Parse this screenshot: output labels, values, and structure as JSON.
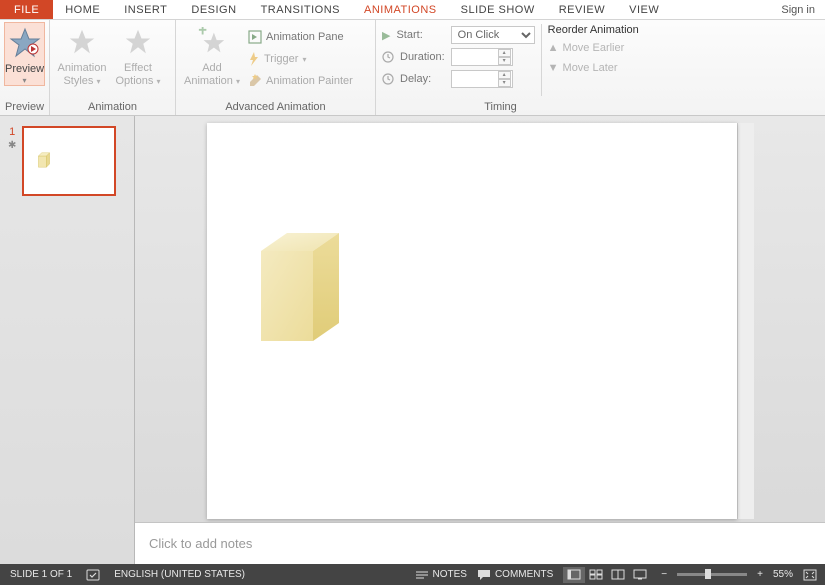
{
  "tabs": {
    "file": "FILE",
    "home": "HOME",
    "insert": "INSERT",
    "design": "DESIGN",
    "transitions": "TRANSITIONS",
    "animations": "ANIMATIONS",
    "slideshow": "SLIDE SHOW",
    "review": "REVIEW",
    "view": "VIEW"
  },
  "signin": "Sign in",
  "ribbon": {
    "preview": {
      "label": "Preview",
      "group": "Preview"
    },
    "animation": {
      "styles": "Animation\nStyles",
      "effect": "Effect\nOptions",
      "group": "Animation"
    },
    "advanced": {
      "add": "Add\nAnimation",
      "pane": "Animation Pane",
      "trigger": "Trigger",
      "painter": "Animation Painter",
      "group": "Advanced Animation"
    },
    "timing": {
      "start_label": "Start:",
      "start_value": "On Click",
      "duration_label": "Duration:",
      "duration_value": "",
      "delay_label": "Delay:",
      "delay_value": "",
      "reorder": "Reorder Animation",
      "earlier": "Move Earlier",
      "later": "Move Later",
      "group": "Timing"
    }
  },
  "thumb": {
    "number": "1"
  },
  "notes_placeholder": "Click to add notes",
  "status": {
    "slide": "SLIDE 1 OF 1",
    "lang": "ENGLISH (UNITED STATES)",
    "notes": "NOTES",
    "comments": "COMMENTS",
    "zoom": "55%"
  }
}
